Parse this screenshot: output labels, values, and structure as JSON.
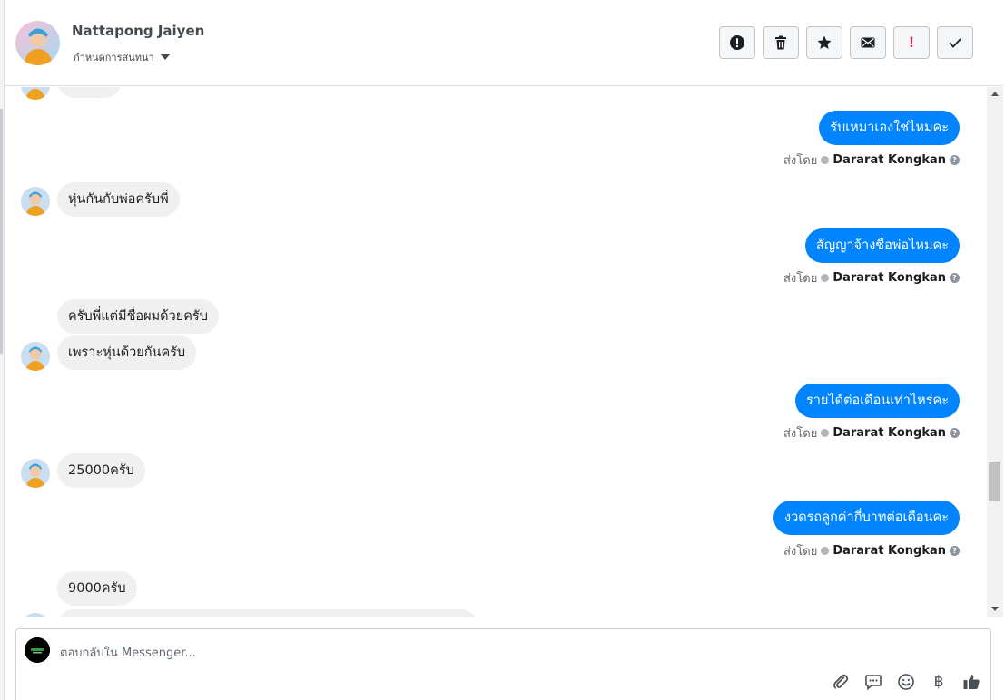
{
  "header": {
    "contact_name": "Nattapong Jaiyen",
    "assign_label": "กำหนดการสนทนา",
    "actions": [
      {
        "name": "spam-button",
        "icon": "alert-circle-icon"
      },
      {
        "name": "delete-button",
        "icon": "trash-icon"
      },
      {
        "name": "star-button",
        "icon": "star-icon"
      },
      {
        "name": "mark-unread-button",
        "icon": "envelope-icon"
      },
      {
        "name": "follow-up-button",
        "icon": "exclamation-icon",
        "label": "!"
      },
      {
        "name": "mark-done-button",
        "icon": "check-icon"
      }
    ]
  },
  "colors": {
    "outgoing_bubble": "#0084ff",
    "incoming_bubble": "#f0f0f0",
    "follow_up_red": "#e41e3f"
  },
  "messages": {
    "m0": {
      "text": ""
    },
    "m1": {
      "text": "รับเหมาเองใช่ไหมคะ",
      "sent_by_label": "ส่งโดย",
      "agent": "Dararat Kongkan"
    },
    "m2": {
      "text": "หุ่นกันกับพ่อครับพี่"
    },
    "m3": {
      "text": "สัญญาจ้างชื่อพ่อไหมคะ",
      "sent_by_label": "ส่งโดย",
      "agent": "Dararat Kongkan"
    },
    "m4": {
      "text": "ครับพี่แต่มีชื่อผมด้วยครับ"
    },
    "m5": {
      "text": "เพราะหุ่นด้วยกันครับ"
    },
    "m6": {
      "text": "รายได้ต่อเดือนเท่าไหร่คะ",
      "sent_by_label": "ส่งโดย",
      "agent": "Dararat Kongkan"
    },
    "m7": {
      "text": "25000ครับ"
    },
    "m8": {
      "text": "งวดรถลูกค่ากี่บาทต่อเดือนคะ",
      "sent_by_label": "ส่งโดย",
      "agent": "Dararat Kongkan"
    },
    "m9": {
      "text": "9000ครับ"
    },
    "m10": {
      "text": ""
    }
  },
  "composer": {
    "placeholder": "ตอบกลับใน Messenger...",
    "tools": [
      "paperclip-icon",
      "speech-bubble-icon",
      "smiley-icon",
      "baht-icon",
      "thumbs-up-icon"
    ],
    "baht_symbol": "฿"
  }
}
